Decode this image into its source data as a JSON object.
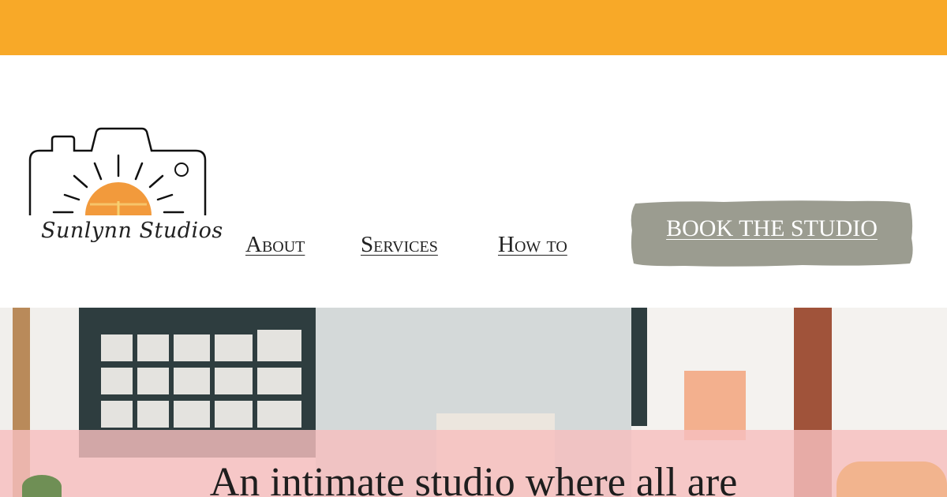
{
  "brand": {
    "name": "Sunlynn Studios"
  },
  "nav": {
    "items": [
      {
        "label": "About"
      },
      {
        "label": "Services"
      },
      {
        "label": "How to"
      }
    ]
  },
  "cta": {
    "label": "BOOK THE STUDIO"
  },
  "hero": {
    "headline": "An intimate studio where all are"
  },
  "colors": {
    "top_bar": "#f8a928",
    "button": "#9b9c90",
    "hero_band": "#f6bebe",
    "text": "#222222"
  }
}
